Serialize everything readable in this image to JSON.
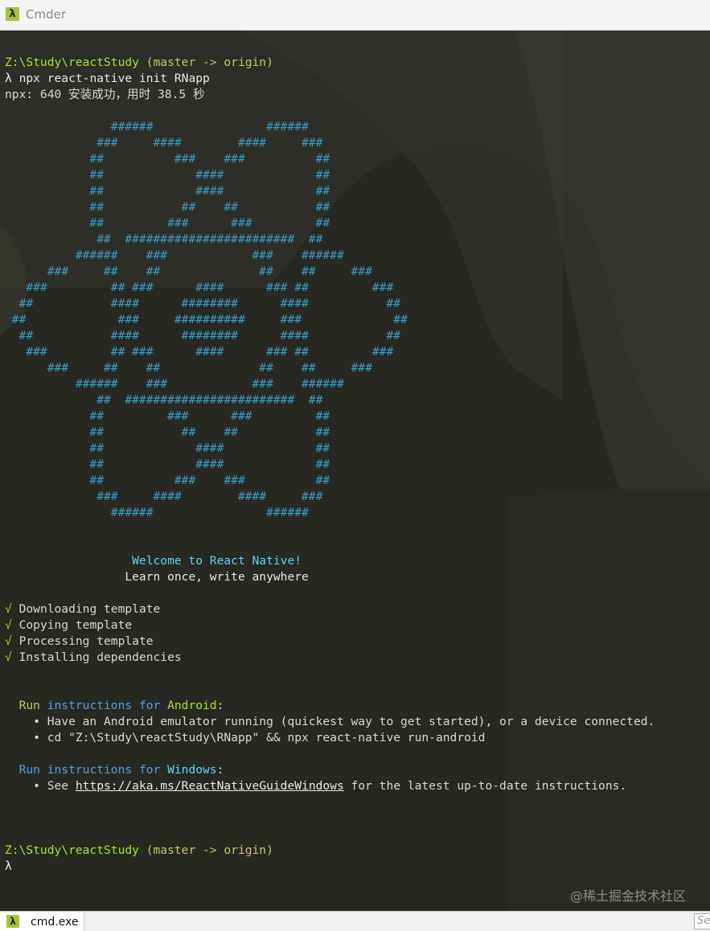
{
  "window": {
    "title": "Cmder",
    "app_icon": "λ"
  },
  "terminal": {
    "prompt1": {
      "path": "Z:\\Study\\reactStudy",
      "branch": " (master -> origin)"
    },
    "command": {
      "prompt_symbol": "λ",
      "text": " npx react-native init RNapp"
    },
    "npx_output": "npx: 640 安装成功，用时 38.5 秒",
    "logo": [
      "               ######                ######",
      "             ###     ####        ####     ###",
      "            ##          ###    ###          ##",
      "            ##             ####             ##",
      "            ##             ####             ##",
      "            ##           ##    ##           ##",
      "            ##         ###      ###         ##",
      "             ##  ########################  ##",
      "          ######    ###            ###    ######",
      "      ###     ##    ##              ##    ##     ###",
      "   ###         ## ###      ####      ### ##         ###",
      "  ##           ####      ########      ####           ##",
      " ##             ###     ##########     ###             ##",
      "  ##           ####      ########      ####           ##",
      "   ###         ## ###      ####      ### ##         ###",
      "      ###     ##    ##              ##    ##     ###",
      "          ######    ###            ###    ######",
      "             ##  ########################  ##",
      "            ##         ###      ###         ##",
      "            ##           ##    ##           ##",
      "            ##             ####             ##",
      "            ##             ####             ##",
      "            ##          ###    ###          ##",
      "             ###     ####        ####     ###",
      "               ######                ######"
    ],
    "welcome": "                  Welcome to React Native!",
    "tagline": "                 Learn once, write anywhere",
    "steps": [
      {
        "check": "√",
        "text": " Downloading template"
      },
      {
        "check": "√",
        "text": " Copying template"
      },
      {
        "check": "√",
        "text": " Processing template"
      },
      {
        "check": "√",
        "text": " Installing dependencies"
      }
    ],
    "android": {
      "run": "  Run",
      "instructions_for": " instructions for ",
      "platform": "Android",
      "colon": ":",
      "bullets": [
        "    • Have an Android emulator running (quickest way to get started), or a device connected.",
        "    • cd \"Z:\\Study\\reactStudy\\RNapp\" && npx react-native run-android"
      ]
    },
    "windows": {
      "run": "  Run",
      "instructions_for": " instructions for ",
      "platform": "Windows",
      "colon": ":",
      "bullet_prefix": "    • See ",
      "link": "https://aka.ms/ReactNativeGuideWindows",
      "bullet_suffix": " for the latest up-to-date instructions."
    },
    "prompt2": {
      "path": "Z:\\Study\\reactStudy",
      "branch": " (master -> origin)"
    },
    "prompt_symbol_final": "λ"
  },
  "watermark": "@稀土掘金技术社区",
  "tabbar": {
    "tab_label": "cmd.exe",
    "search_placeholder": "Search"
  },
  "colors": {
    "background": "#272822",
    "path_green": "#a6e22e",
    "logo_blue": "#3d9bc4",
    "welcome_cyan": "#64d0f2",
    "check_green": "#9fd22a"
  }
}
